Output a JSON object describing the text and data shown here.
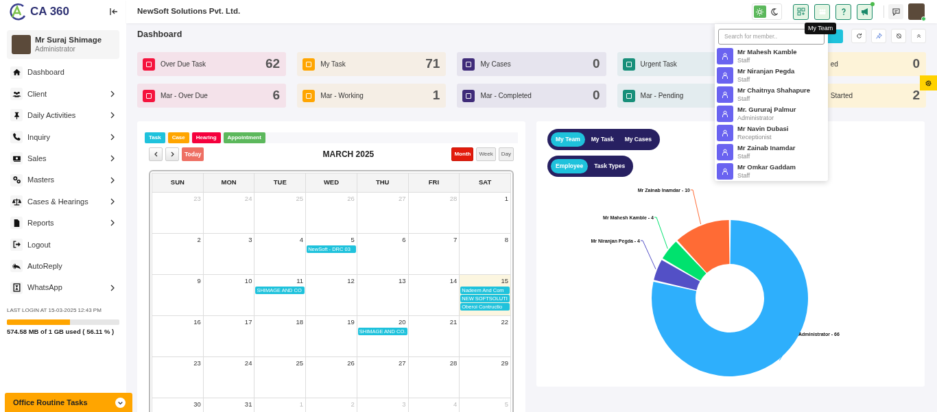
{
  "sidebar": {
    "logo": "CA 360",
    "user": {
      "name": "Mr Suraj Shimage",
      "role": "Administrator"
    },
    "menu": [
      {
        "label": "Dashboard",
        "kind": "home",
        "submenu": false
      },
      {
        "label": "Client",
        "kind": "users",
        "submenu": true
      },
      {
        "label": "Daily Activities",
        "kind": "pin",
        "submenu": true
      },
      {
        "label": "Inquiry",
        "kind": "phone",
        "submenu": true
      },
      {
        "label": "Sales",
        "kind": "money",
        "submenu": true
      },
      {
        "label": "Masters",
        "kind": "gears",
        "submenu": true
      },
      {
        "label": "Cases & Hearings",
        "kind": "scale",
        "submenu": true
      },
      {
        "label": "Reports",
        "kind": "file",
        "submenu": true
      },
      {
        "label": "Logout",
        "kind": "logout",
        "submenu": false
      },
      {
        "label": "AutoReply",
        "kind": "reply",
        "submenu": false
      },
      {
        "label": "WhatsApp",
        "kind": "hourglass",
        "submenu": true
      }
    ],
    "last_login": "LAST LOGIN AT 15-03-2025 12:43 PM",
    "storage": {
      "level": 0.5611,
      "reading": "574.58 MB of 1 GB used ( 56.11 % )"
    },
    "routine_bar": "Office Routine Tasks"
  },
  "header": {
    "company": "NewSoft Solutions Pvt. Ltd.",
    "light_mode": true,
    "announcement_dot": true,
    "online": true,
    "tooltip": "My Team"
  },
  "page_title": "Dashboard",
  "stats": [
    {
      "label": "Over Due Task",
      "value": "62",
      "color": "#f5133d",
      "covered": false
    },
    {
      "label": "My Task",
      "value": "71",
      "color": "#ffa500",
      "covered": false
    },
    {
      "label": "My Cases",
      "value": "0",
      "color": "#3f2b79",
      "covered": false
    },
    {
      "label": "Urgent Task",
      "color": "#188f7a",
      "covered": false,
      "cut_off": true
    },
    {
      "label": "ed",
      "value": "0",
      "covered": true
    },
    {
      "label": "Mar - Over Due",
      "value": "6",
      "color": "#f5133d",
      "covered": false
    },
    {
      "label": "Mar - Working",
      "value": "1",
      "color": "#ffa500",
      "covered": false
    },
    {
      "label": "Mar - Completed",
      "value": "0",
      "color": "#3f2b79",
      "covered": false
    },
    {
      "label": "Mar - Pending",
      "color": "#188f7a",
      "covered": false,
      "cut_off": true
    },
    {
      "label": "Started",
      "value": "2",
      "covered": true
    }
  ],
  "calendar": {
    "legend": [
      {
        "label": "Task",
        "color": "#1fc2dc"
      },
      {
        "label": "Case",
        "color": "#ffa500"
      },
      {
        "label": "Hearing",
        "color": "#f5003d"
      },
      {
        "label": "Appointment",
        "color": "#5cb85c"
      }
    ],
    "today_button": "Today",
    "title": "MARCH 2025",
    "views": [
      {
        "label": "Month",
        "selected": true
      },
      {
        "label": "Week",
        "selected": false
      },
      {
        "label": "Day",
        "selected": false
      }
    ],
    "weekdays": [
      "SUN",
      "MON",
      "TUE",
      "WED",
      "THU",
      "FRI",
      "SAT"
    ],
    "weeks": [
      [
        {
          "day": "23",
          "muted": true,
          "today": false
        },
        {
          "day": "24",
          "muted": true,
          "today": false
        },
        {
          "day": "25",
          "muted": true,
          "today": false
        },
        {
          "day": "26",
          "muted": true,
          "today": false
        },
        {
          "day": "27",
          "muted": true,
          "today": false
        },
        {
          "day": "28",
          "muted": true,
          "today": false
        },
        {
          "day": "1",
          "muted": false,
          "today": false
        }
      ],
      [
        {
          "day": "2",
          "muted": false,
          "today": false
        },
        {
          "day": "3",
          "muted": false,
          "today": false
        },
        {
          "day": "4",
          "muted": false,
          "today": false
        },
        {
          "day": "5",
          "muted": false,
          "today": false,
          "events": [
            "NewSoft - DRC 03"
          ]
        },
        {
          "day": "6",
          "muted": false,
          "today": false
        },
        {
          "day": "7",
          "muted": false,
          "today": false
        },
        {
          "day": "8",
          "muted": false,
          "today": false
        }
      ],
      [
        {
          "day": "9",
          "muted": false,
          "today": false
        },
        {
          "day": "10",
          "muted": false,
          "today": false
        },
        {
          "day": "11",
          "muted": false,
          "today": false,
          "events": [
            "SHIMAGE AND CO"
          ]
        },
        {
          "day": "12",
          "muted": false,
          "today": false
        },
        {
          "day": "13",
          "muted": false,
          "today": false
        },
        {
          "day": "14",
          "muted": false,
          "today": false
        },
        {
          "day": "15",
          "muted": false,
          "today": true,
          "events": [
            "Nadeem And Com",
            "NEW SOFTSOLUTI",
            "Oberoi Contructio"
          ]
        }
      ],
      [
        {
          "day": "16",
          "muted": false,
          "today": false
        },
        {
          "day": "17",
          "muted": false,
          "today": false
        },
        {
          "day": "18",
          "muted": false,
          "today": false
        },
        {
          "day": "19",
          "muted": false,
          "today": false
        },
        {
          "day": "20",
          "muted": false,
          "today": false,
          "events": [
            "SHIMAGE AND CO."
          ]
        },
        {
          "day": "21",
          "muted": false,
          "today": false
        },
        {
          "day": "22",
          "muted": false,
          "today": false
        }
      ],
      [
        {
          "day": "23",
          "muted": false,
          "today": false
        },
        {
          "day": "24",
          "muted": false,
          "today": false
        },
        {
          "day": "25",
          "muted": false,
          "today": false
        },
        {
          "day": "26",
          "muted": false,
          "today": false
        },
        {
          "day": "27",
          "muted": false,
          "today": false
        },
        {
          "day": "28",
          "muted": false,
          "today": false
        },
        {
          "day": "29",
          "muted": false,
          "today": false
        }
      ],
      [
        {
          "day": "30",
          "muted": false,
          "today": false
        },
        {
          "day": "31",
          "muted": false,
          "today": false
        },
        {
          "day": "1",
          "muted": true,
          "today": false
        },
        {
          "day": "2",
          "muted": true,
          "today": false
        },
        {
          "day": "3",
          "muted": true,
          "today": false
        },
        {
          "day": "4",
          "muted": true,
          "today": false
        },
        {
          "day": "5",
          "muted": true,
          "today": false
        }
      ]
    ]
  },
  "chart_panel": {
    "scope_tabs": [
      {
        "label": "My Team",
        "selected": true
      },
      {
        "label": "My Task",
        "selected": false
      },
      {
        "label": "My Cases",
        "selected": false
      }
    ],
    "group_tabs": [
      {
        "label": "Employee",
        "selected": true
      },
      {
        "label": "Task Types",
        "selected": false
      }
    ],
    "chart_data": {
      "type": "donut",
      "categories": [
        "Administrator - 66",
        "Mr Niranjan Pegda - 4",
        "Mr Mahesh Kamble - 4",
        "Mr Zainab Inamdar - 10"
      ],
      "series": [
        {
          "values": [
            78.57,
            4.76,
            4.76,
            11.91
          ]
        }
      ],
      "colors": [
        "#2eaffc",
        "#5350c6",
        "#00e26e",
        "#ff6b35"
      ]
    }
  },
  "team_dropdown": {
    "placeholder": "Search for member..",
    "members": [
      {
        "name": "Mr Mahesh Kamble",
        "role": "Staff"
      },
      {
        "name": "Mr Niranjan Pegda",
        "role": "Staff"
      },
      {
        "name": "Mr Chaitnya Shahapure",
        "role": "Staff"
      },
      {
        "name": "Mr. Gururaj Palmur",
        "role": "Administrator"
      },
      {
        "name": "Mr Navin Dubasi",
        "role": "Receptionist"
      },
      {
        "name": "Mr Zainab Inamdar",
        "role": "Staff"
      },
      {
        "name": "Mr Omkar Gaddam",
        "role": "Staff"
      }
    ]
  }
}
